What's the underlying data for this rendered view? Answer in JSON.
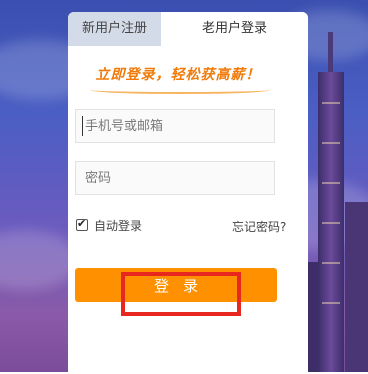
{
  "tabs": {
    "register_label": "新用户注册",
    "login_label": "老用户登录",
    "active": "login"
  },
  "slogan": "立即登录，轻松获高薪！",
  "form": {
    "account_placeholder": "手机号或邮箱",
    "account_value": "",
    "password_placeholder": "密码",
    "password_value": "",
    "remember_label": "自动登录",
    "remember_checked": true,
    "forgot_label": "忘记密码?",
    "login_button_label": "登录"
  },
  "colors": {
    "accent": "#ff9100",
    "slogan": "#f07a0a",
    "inactive_tab": "#d3dbe8",
    "highlight": "#e8281e"
  },
  "icons": {
    "checkbox": "check-icon"
  }
}
